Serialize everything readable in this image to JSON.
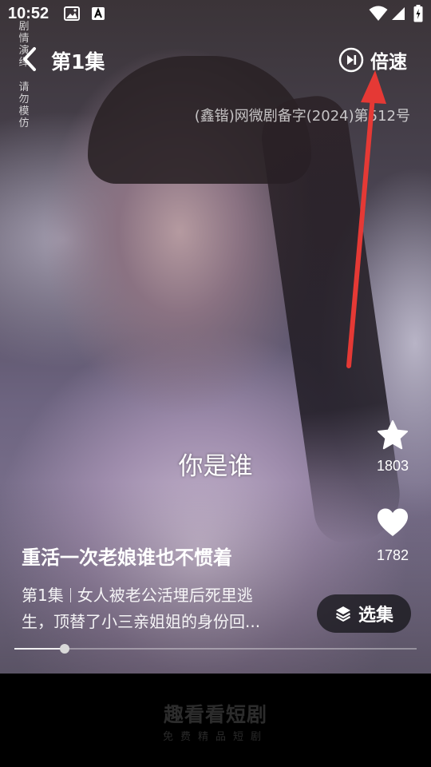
{
  "status_bar": {
    "time": "10:52",
    "icons": [
      "gallery-notification-icon",
      "text-notification-icon",
      "wifi-icon",
      "signal-icon",
      "battery-icon"
    ]
  },
  "disclaimer": {
    "part1": [
      "剧",
      "情",
      "演",
      "绎"
    ],
    "part2": [
      "请",
      "勿",
      "模",
      "仿"
    ]
  },
  "header": {
    "episode_title": "第1集",
    "speed_label": "倍速"
  },
  "license_text": "(鑫锴)网微剧备字(2024)第512号",
  "subtitle": "你是谁",
  "actions": {
    "favorite_count": "1803",
    "like_count": "1782"
  },
  "drama": {
    "title": "重活一次老娘谁也不惯着",
    "episode": "第1集",
    "description_line1": "女人被老公活埋后死里逃",
    "description_line2": "生，顶替了小三亲姐姐的身份回..."
  },
  "episodes_button": {
    "label": "选集"
  },
  "progress": {
    "played_fraction": 0.125
  },
  "footer": {
    "brand_name": "趣看看短剧",
    "slogan": "免费精品短剧"
  },
  "colors": {
    "annotation_arrow": "#e53935",
    "footer_text": "#2c2c2c"
  }
}
